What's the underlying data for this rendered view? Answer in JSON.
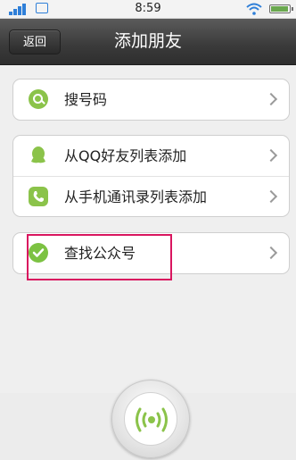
{
  "status_bar": {
    "time": "8:59",
    "signal_icon": "signal-bars-icon",
    "photo_icon": "photo-icon",
    "wifi_icon": "wifi-icon",
    "battery_icon": "battery-icon"
  },
  "nav": {
    "back_label": "返回",
    "title": "添加朋友"
  },
  "groups": [
    [
      {
        "label": "搜号码",
        "icon": "search-icon"
      }
    ],
    [
      {
        "label": "从QQ好友列表添加",
        "icon": "qq-icon"
      },
      {
        "label": "从手机通讯录列表添加",
        "icon": "phone-icon"
      }
    ],
    [
      {
        "label": "查找公众号",
        "icon": "checkmark-icon"
      }
    ]
  ],
  "bottom": {
    "radar_icon": "radar-signal-icon"
  },
  "colors": {
    "accent_green": "#8bc34a",
    "highlight": "#d9165f",
    "nav_bg": "#3a3a3a"
  }
}
